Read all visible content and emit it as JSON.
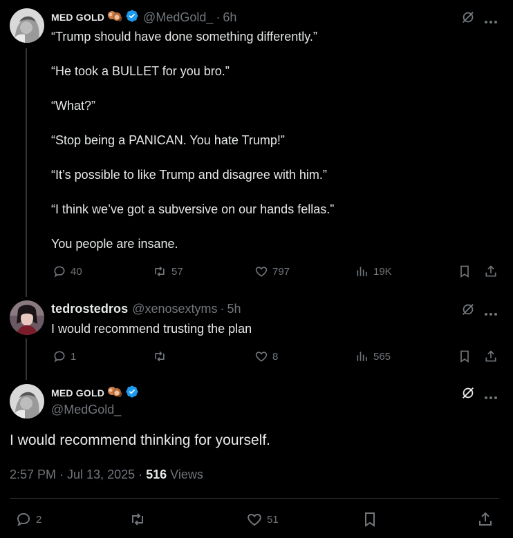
{
  "tweet1": {
    "display_name": "MED GOLD",
    "handle": "@MedGold_",
    "time": "6h",
    "lines": [
      "“Trump should have done something differently.”",
      "“He took a BULLET for you bro.”",
      "“What?”",
      "“Stop being a PANICAN. You hate Trump!”",
      "“It’s possible to like Trump and disagree with him.”",
      "“I think we’ve got a subversive on our hands fellas.”",
      "You people are insane."
    ],
    "replies": "40",
    "reposts": "57",
    "likes": "797",
    "views": "19K"
  },
  "tweet2": {
    "display_name": "tedrostedros",
    "handle": "@xenosextyms",
    "time": "5h",
    "text": "I would recommend trusting the plan",
    "replies": "1",
    "reposts": "",
    "likes": "8",
    "views": "565"
  },
  "tweet3": {
    "display_name": "MED GOLD",
    "handle": "@MedGold_",
    "text": "I would recommend thinking for yourself.",
    "timestamp": "2:57 PM · Jul 13, 2025",
    "view_count": "516",
    "views_label": "Views",
    "replies": "2",
    "reposts": "",
    "likes": "51"
  },
  "separator": "·",
  "colors": {
    "background": "#000000",
    "text": "#e7e9ea",
    "muted": "#71767b",
    "verified": "#1d9bf0"
  }
}
